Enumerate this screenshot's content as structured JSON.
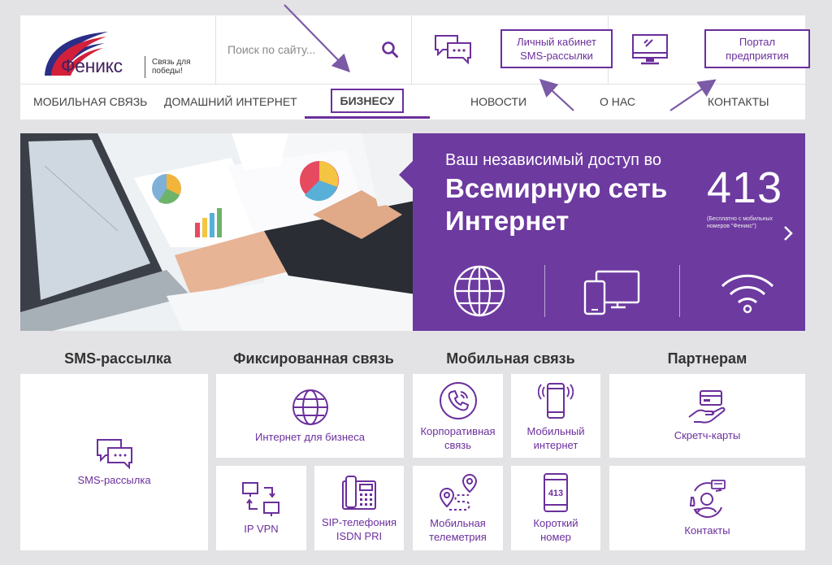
{
  "brand": {
    "name": "Феникс",
    "tagline": "Связь для победы!"
  },
  "search": {
    "placeholder": "Поиск по сайту..."
  },
  "header_buttons": {
    "sms_cabinet_line1": "Личный кабинет",
    "sms_cabinet_line2": "SMS-рассылки",
    "portal_line1": "Портал",
    "portal_line2": "предприятия"
  },
  "nav": {
    "items": [
      {
        "label": "МОБИЛЬНАЯ СВЯЗЬ"
      },
      {
        "label": "ДОМАШНИЙ ИНТЕРНЕТ"
      },
      {
        "label": "БИЗНЕСУ"
      },
      {
        "label": "НОВОСТИ"
      },
      {
        "label": "О НАС"
      },
      {
        "label": "КОНТАКТЫ"
      }
    ]
  },
  "banner": {
    "subtitle": "Ваш независимый доступ во",
    "title_line1": "Всемирную сеть",
    "title_line2": "Интернет",
    "number": "413",
    "number_note_line1": "(Бесплатно с мобильных",
    "number_note_line2": "номеров \"Феникс\")"
  },
  "categories": {
    "sms": "SMS-рассылка",
    "fixed": "Фиксированная связь",
    "mobile": "Мобильная связь",
    "partners": "Партнерам"
  },
  "tiles": {
    "sms": "SMS-рассылка",
    "internet_business": "Интернет для бизнеса",
    "ip_vpn": "IP VPN",
    "sip_line1": "SIP-телефония",
    "sip_line2": "ISDN PRI",
    "corporate_line1": "Корпоративная",
    "corporate_line2": "связь",
    "mobile_internet_line1": "Мобильный",
    "mobile_internet_line2": "интернет",
    "telemetry_line1": "Мобильная",
    "telemetry_line2": "телеметрия",
    "short_number_line1": "Короткий",
    "short_number_line2": "номер",
    "short_number_code": "413",
    "scratch_cards": "Скретч-карты",
    "contacts": "Контакты"
  },
  "colors": {
    "accent": "#6b2f9c",
    "banner": "#6d3aa0",
    "background": "#e3e3e5"
  }
}
